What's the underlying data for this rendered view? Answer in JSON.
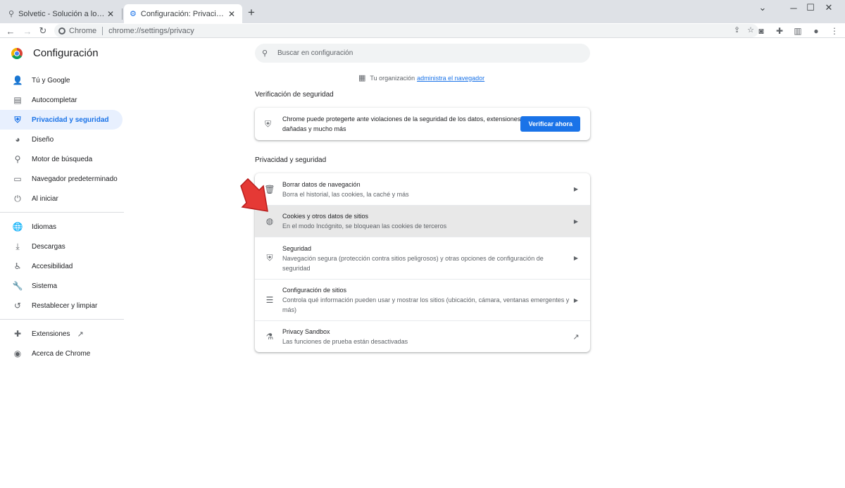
{
  "tabs": [
    {
      "title": "Solvetic - Solución a los problemas",
      "icon": "search-icon"
    },
    {
      "title": "Configuración: Privacidad y seguridad",
      "icon": "gear-icon"
    }
  ],
  "omnibox": {
    "site_chip": "Chrome",
    "url_scheme": "chrome://",
    "url_path": "settings/privacy"
  },
  "header": {
    "title": "Configuración"
  },
  "search": {
    "placeholder": "Buscar en configuración"
  },
  "sidebar": {
    "items": [
      {
        "label": "Tú y Google",
        "icon": "person-icon"
      },
      {
        "label": "Autocompletar",
        "icon": "clipboard-icon"
      },
      {
        "label": "Privacidad y seguridad",
        "icon": "shield-icon",
        "active": true
      },
      {
        "label": "Diseño",
        "icon": "palette-icon"
      },
      {
        "label": "Motor de búsqueda",
        "icon": "search-icon"
      },
      {
        "label": "Navegador predeterminado",
        "icon": "browser-icon"
      },
      {
        "label": "Al iniciar",
        "icon": "power-icon"
      },
      {
        "label": "Idiomas",
        "icon": "globe-icon"
      },
      {
        "label": "Descargas",
        "icon": "download-icon"
      },
      {
        "label": "Accesibilidad",
        "icon": "accessibility-icon"
      },
      {
        "label": "Sistema",
        "icon": "wrench-icon"
      },
      {
        "label": "Restablecer y limpiar",
        "icon": "restore-icon"
      },
      {
        "label": "Extensiones",
        "icon": "puzzle-icon"
      },
      {
        "label": "Acerca de Chrome",
        "icon": "chrome-icon"
      }
    ]
  },
  "org": {
    "prefix": "Tu organización",
    "link": "administra el navegador"
  },
  "safety": {
    "section_title": "Verificación de seguridad",
    "text": "Chrome puede protegerte ante violaciones de la seguridad de los datos, extensiones dañadas y mucho más",
    "button": "Verificar ahora"
  },
  "privacy": {
    "section_title": "Privacidad y seguridad",
    "rows": [
      {
        "title": "Borrar datos de navegación",
        "subtitle": "Borra el historial, las cookies, la caché y más",
        "icon": "trash-icon"
      },
      {
        "title": "Cookies y otros datos de sitios",
        "subtitle": "En el modo Incógnito, se bloquean las cookies de terceros",
        "icon": "cookie-icon"
      },
      {
        "title": "Seguridad",
        "subtitle": "Navegación segura (protección contra sitios peligrosos) y otras opciones de configuración de seguridad",
        "icon": "shield-icon"
      },
      {
        "title": "Configuración de sitios",
        "subtitle": "Controla qué información pueden usar y mostrar los sitios (ubicación, cámara, ventanas emergentes y más)",
        "icon": "sliders-icon"
      },
      {
        "title": "Privacy Sandbox",
        "subtitle": "Las funciones de prueba están desactivadas",
        "icon": "flask-icon"
      }
    ]
  },
  "colors": {
    "accent": "#1a73e8",
    "active_bg": "#e8f0fe",
    "highlight_row": "#e8e8e8",
    "arrow": "#e53935"
  }
}
